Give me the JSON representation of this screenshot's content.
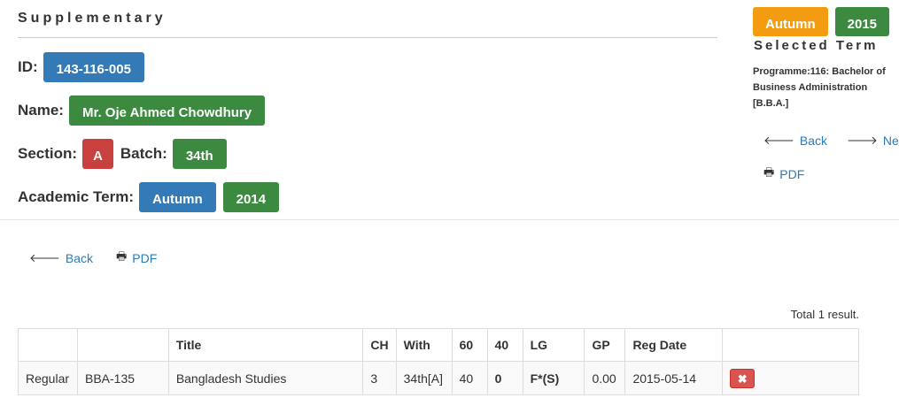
{
  "page": {
    "heading": "Supplementary"
  },
  "student": {
    "id_label": "ID:",
    "id": "143-116-005",
    "name_label": "Name:",
    "name": "Mr. Oje Ahmed Chowdhury",
    "section_label": "Section:",
    "section": "A",
    "batch_label": "Batch:",
    "batch": "34th",
    "term_label": "Academic Term:",
    "term_season": "Autumn",
    "term_year": "2014"
  },
  "selected_term": {
    "season": "Autumn",
    "year": "2015",
    "label": "Selected Term",
    "programme": "Programme:116: Bachelor of Business Administration [B.B.A.]"
  },
  "nav": {
    "back": "Back",
    "next": "Next",
    "pdf": "PDF"
  },
  "results": {
    "total": "Total 1 result.",
    "columns": [
      "",
      "",
      "Title",
      "CH",
      "With",
      "60",
      "40",
      "LG",
      "GP",
      "Reg Date",
      ""
    ],
    "rows": [
      {
        "type": "Regular",
        "code": "BBA-135",
        "title": "Bangladesh Studies",
        "ch": "3",
        "with": "34th[A]",
        "c60": "40",
        "c40": "0",
        "lg": "F*(S)",
        "gp": "0.00",
        "reg_date": "2015-05-14"
      }
    ]
  },
  "colors": {
    "blue": "#337ab7",
    "green": "#3c8a3f",
    "red": "#c9413f",
    "orange": "#f39c12",
    "link": "#2a7ab8"
  },
  "icons": {
    "back": "arrow-left-icon",
    "next": "arrow-right-icon",
    "pdf": "print-icon",
    "delete": "times-icon"
  }
}
